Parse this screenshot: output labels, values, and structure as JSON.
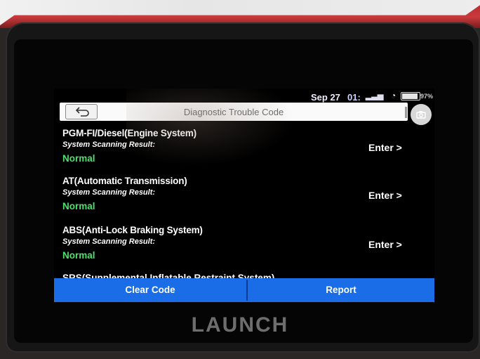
{
  "status": {
    "date": "Sep 27",
    "time": "01:",
    "battery_pct": "97%"
  },
  "header": {
    "title": "Diagnostic Trouble Code",
    "back_icon": "back-arrow-icon",
    "camera_icon": "camera-icon"
  },
  "systems": [
    {
      "name": "PGM-FI/Diesel(Engine System)",
      "scan_label": "System Scanning Result:",
      "result": "Normal",
      "action": "Enter >"
    },
    {
      "name": "AT(Automatic Transmission)",
      "scan_label": "System Scanning Result:",
      "result": "Normal",
      "action": "Enter >"
    },
    {
      "name": "ABS(Anti-Lock Braking System)",
      "scan_label": "System Scanning Result:",
      "result": "Normal",
      "action": "Enter >"
    }
  ],
  "partial_item": "SRS(Supplemental Inflatable Restraint System)",
  "footer": {
    "clear_label": "Clear Code",
    "report_label": "Report"
  },
  "device": {
    "brand": "LAUNCH"
  },
  "colors": {
    "accent_blue": "#1a6de6",
    "normal_green": "#4ee06c"
  }
}
